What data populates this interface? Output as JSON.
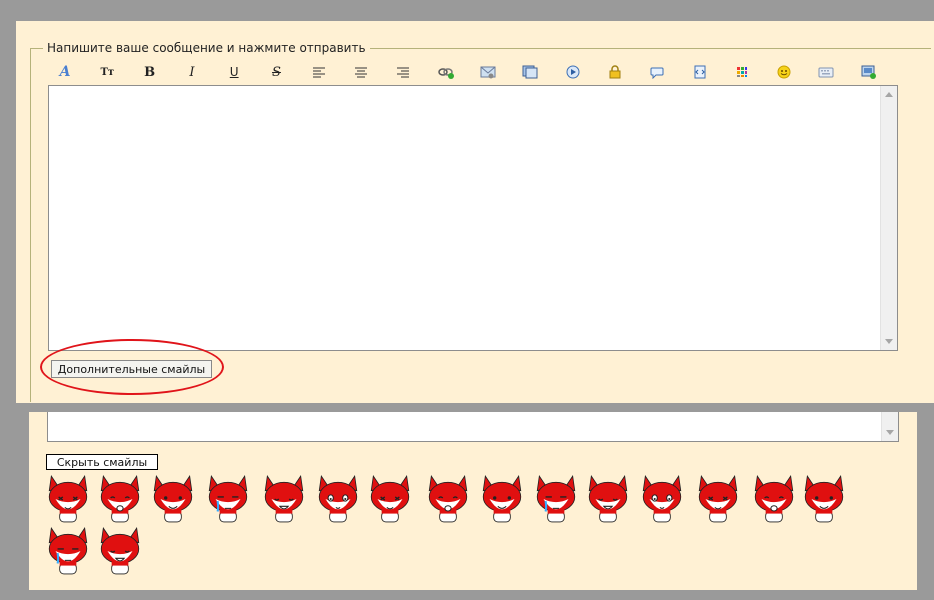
{
  "editor": {
    "legend": "Напишите ваше сообщение и нажмите отправить",
    "toolbar": [
      {
        "name": "font-color-icon",
        "glyph": "A"
      },
      {
        "name": "font-size-icon",
        "glyph": "Tт"
      },
      {
        "name": "bold-icon",
        "glyph": "B"
      },
      {
        "name": "italic-icon",
        "glyph": "I"
      },
      {
        "name": "underline-icon",
        "glyph": "U"
      },
      {
        "name": "strikethrough-icon",
        "glyph": "S"
      },
      {
        "name": "align-left-icon",
        "glyph": ""
      },
      {
        "name": "align-center-icon",
        "glyph": ""
      },
      {
        "name": "align-right-icon",
        "glyph": ""
      },
      {
        "name": "insert-link-icon",
        "glyph": ""
      },
      {
        "name": "insert-image-icon",
        "glyph": ""
      },
      {
        "name": "insert-media-icon",
        "glyph": ""
      },
      {
        "name": "insert-video-icon",
        "glyph": ""
      },
      {
        "name": "hide-text-lock-icon",
        "glyph": ""
      },
      {
        "name": "quote-icon",
        "glyph": ""
      },
      {
        "name": "code-icon",
        "glyph": ""
      },
      {
        "name": "color-palette-icon",
        "glyph": ""
      },
      {
        "name": "smiley-icon",
        "glyph": ""
      },
      {
        "name": "keyboard-icon",
        "glyph": ""
      },
      {
        "name": "upload-image-icon",
        "glyph": ""
      }
    ],
    "more_smilies_label": "Дополнительные смайлы",
    "hide_smilies_label": "Скрыть смайлы"
  },
  "colors": {
    "panel_bg": "#fff1d4",
    "page_bg": "#9a9a9a",
    "highlight": "#e0141a",
    "fox_red": "#e01010"
  },
  "smilies_count": 17
}
